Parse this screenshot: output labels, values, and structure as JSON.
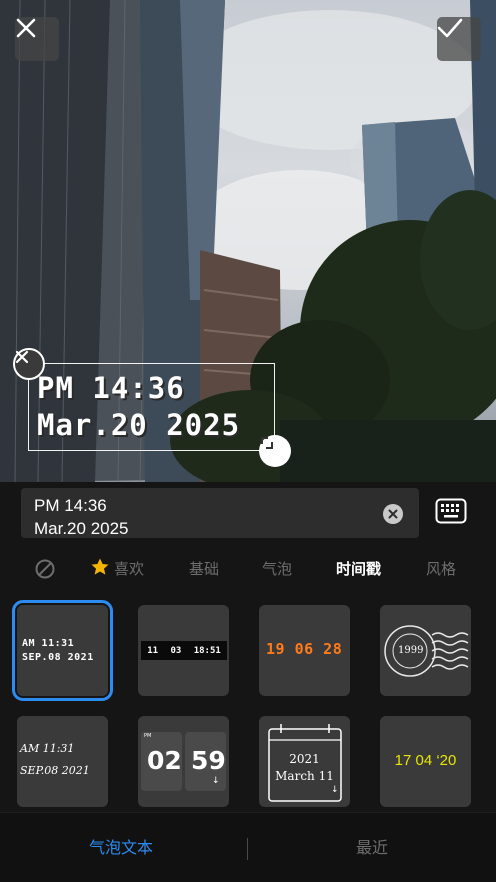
{
  "sticker": {
    "line1": "PM 14:36",
    "line2": "Mar.20 2025"
  },
  "text_field": {
    "line1": "PM 14:36",
    "line2": "Mar.20 2025"
  },
  "tabs": [
    {
      "label": "",
      "icon": "none-icon"
    },
    {
      "label": "喜欢",
      "icon": "star-icon"
    },
    {
      "label": "基础"
    },
    {
      "label": "气泡"
    },
    {
      "label": "时间戳",
      "active": true
    },
    {
      "label": "风格"
    }
  ],
  "styles": [
    {
      "line1": "AM 11:31",
      "line2": "SEP.08 2021",
      "selected": true
    },
    {
      "parts": [
        "11",
        "03",
        "18:51"
      ]
    },
    {
      "text": "19 06 28",
      "color": "#ff7a1a"
    },
    {
      "text": "1999",
      "icon": "postmark-stamp-icon"
    },
    {
      "line1": "AM 11:31",
      "line2": "SEP.08 2021"
    },
    {
      "small": "PM",
      "left": "02",
      "right": "59"
    },
    {
      "year": "2021",
      "date": "March 11",
      "icon": "calendar-icon"
    },
    {
      "text": "17 04 ‘20",
      "color": "#e6e600"
    }
  ],
  "bottom_tabs": [
    {
      "label": "气泡文本",
      "active": true,
      "color": "#2d8cf0"
    },
    {
      "label": "最近"
    }
  ]
}
